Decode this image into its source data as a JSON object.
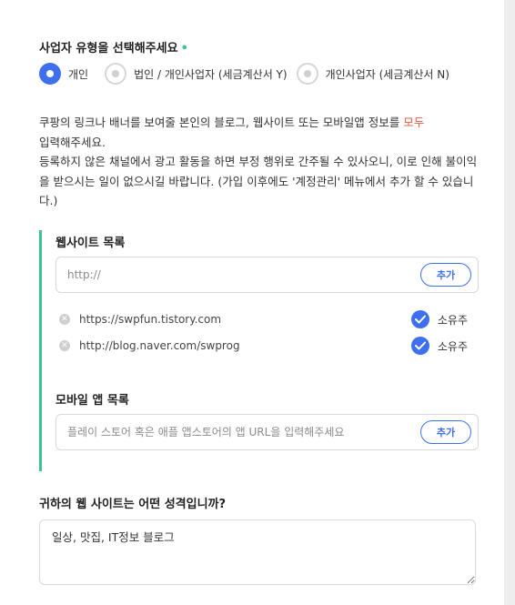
{
  "business_type": {
    "title": "사업자 유형을 선택해주세요",
    "required_mark": "•",
    "options": [
      {
        "label": "개인",
        "selected": true
      },
      {
        "label": "법인 / 개인사업자 (세금계산서 Y)",
        "selected": false
      },
      {
        "label": "개인사업자 (세금계산서 N)",
        "selected": false
      }
    ]
  },
  "description": {
    "line1_prefix": "쿠팡의 링크나 배너를 보여줄 본인의 블로그, 웹사이트 또는 모바일앱 정보를 ",
    "line1_highlight": "모두",
    "line1_suffix": "입력해주세요.",
    "line2": "등록하지 않은 채널에서 광고 활동을 하면 부정 행위로 간주될 수 있사오니, 이로 인해 불이익을 받으시는 일이 없으시길 바랍니다. (가입 이후에도 '계정관리' 메뉴에서 추가 할 수 있습니다.)",
    "highlight_color": "#e8593c"
  },
  "websites": {
    "title": "웹사이트 목록",
    "input_placeholder": "http://",
    "add_label": "추가",
    "items": [
      {
        "url": "https://swpfun.tistory.com",
        "owner_label": "소유주",
        "checked": true
      },
      {
        "url": "http://blog.naver.com/swprog",
        "owner_label": "소유주",
        "checked": true
      }
    ]
  },
  "mobile_apps": {
    "title": "모바일 앱 목록",
    "input_placeholder": "플레이 스토어 혹은 애플 앱스토어의 앱 URL을 입력해주세요",
    "add_label": "추가"
  },
  "website_nature": {
    "title": "귀하의 웹 사이트는 어떤 성격입니까?",
    "value": "일상, 맛집, IT정보 블로그"
  },
  "colors": {
    "accent": "#3f6ff1",
    "panel_border": "#3ec28f",
    "required": "#3ec28f"
  }
}
